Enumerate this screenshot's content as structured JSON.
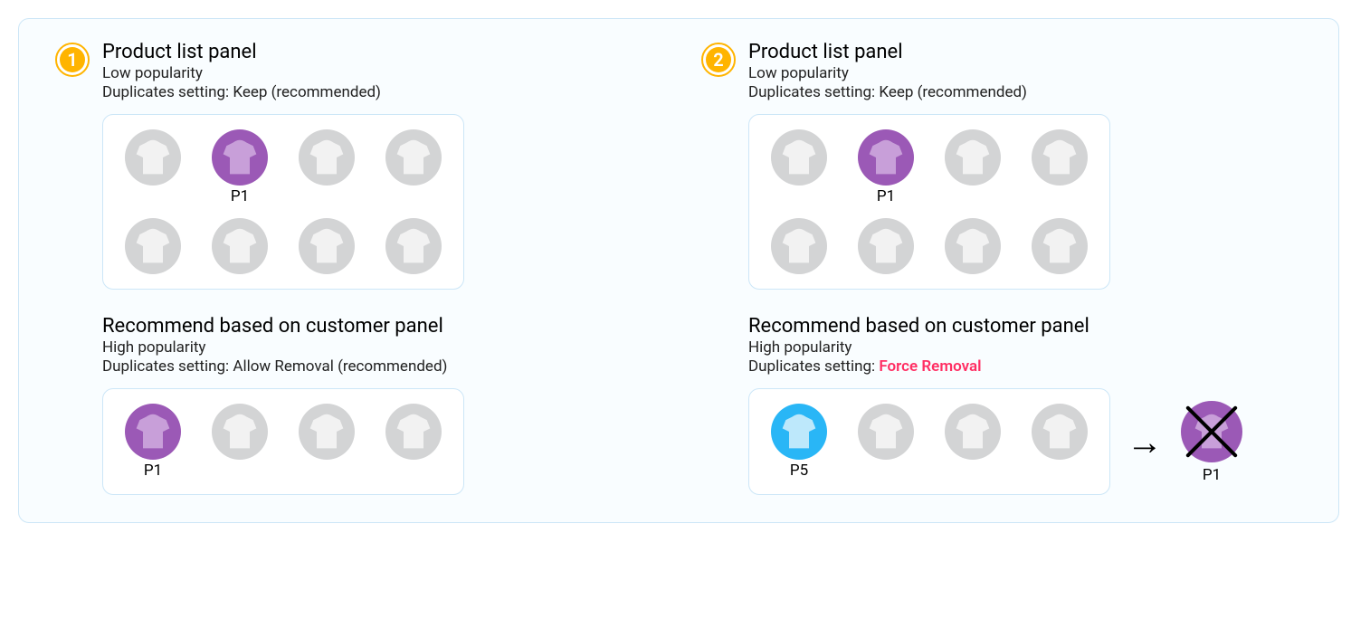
{
  "badges": {
    "one": "1",
    "two": "2"
  },
  "left": {
    "top": {
      "title": "Product list panel",
      "sub1": "Low popularity",
      "sub2": "Duplicates setting: Keep (recommended)",
      "highlighted": "P1"
    },
    "bottom": {
      "title": "Recommend based on customer panel",
      "sub1": "High popularity",
      "sub2": "Duplicates setting: Allow Removal (recommended)",
      "highlighted": "P1"
    }
  },
  "right": {
    "top": {
      "title": "Product list panel",
      "sub1": "Low popularity",
      "sub2": "Duplicates setting: Keep (recommended)",
      "highlighted": "P1"
    },
    "bottom": {
      "title": "Recommend based on customer panel",
      "sub1": "High popularity",
      "sub2_prefix": "Duplicates setting: ",
      "sub2_highlight": "Force Removal",
      "highlighted": "P5",
      "removed": "P1"
    }
  },
  "arrow": "→"
}
